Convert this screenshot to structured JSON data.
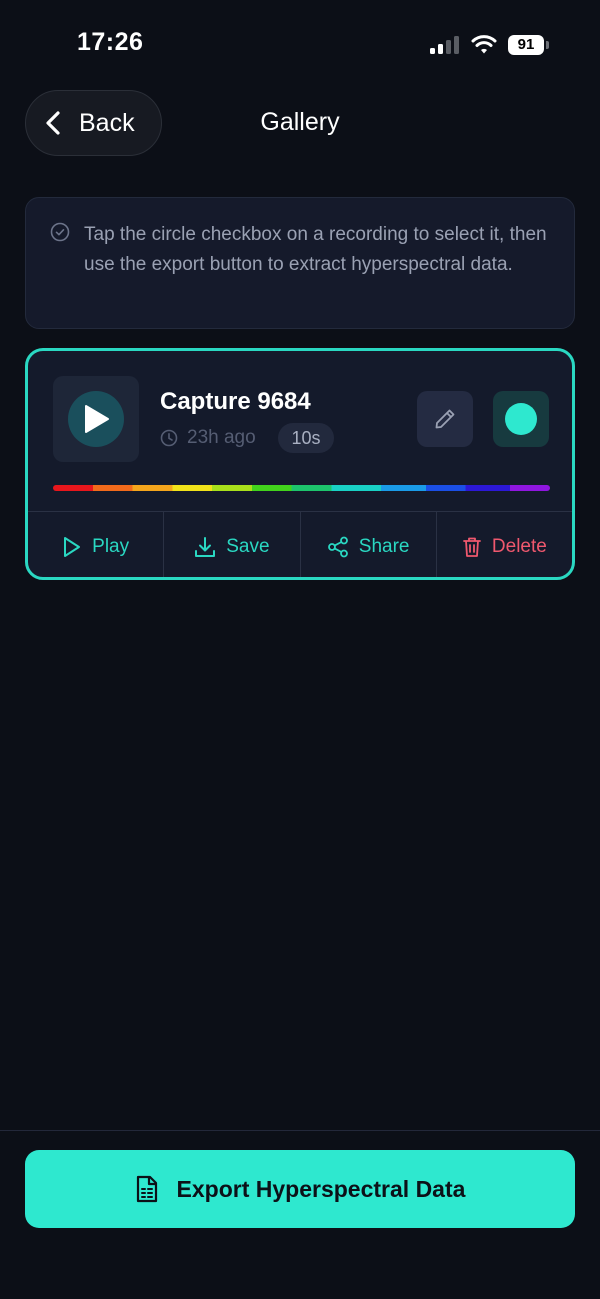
{
  "status_bar": {
    "time": "17:26",
    "battery": "91"
  },
  "header": {
    "back_label": "Back",
    "title": "Gallery"
  },
  "hint": {
    "text": "Tap the circle checkbox on a recording to select it, then use the export button to extract hyperspectral data."
  },
  "capture": {
    "title": "Capture 9684",
    "time_ago": "23h ago",
    "duration": "10s",
    "selected": true,
    "actions": {
      "play": "Play",
      "save": "Save",
      "share": "Share",
      "delete": "Delete"
    }
  },
  "export": {
    "label": "Export Hyperspectral Data"
  },
  "colors": {
    "accent": "#2ee8cf",
    "danger": "#f0586e",
    "background": "#0c0f17"
  }
}
